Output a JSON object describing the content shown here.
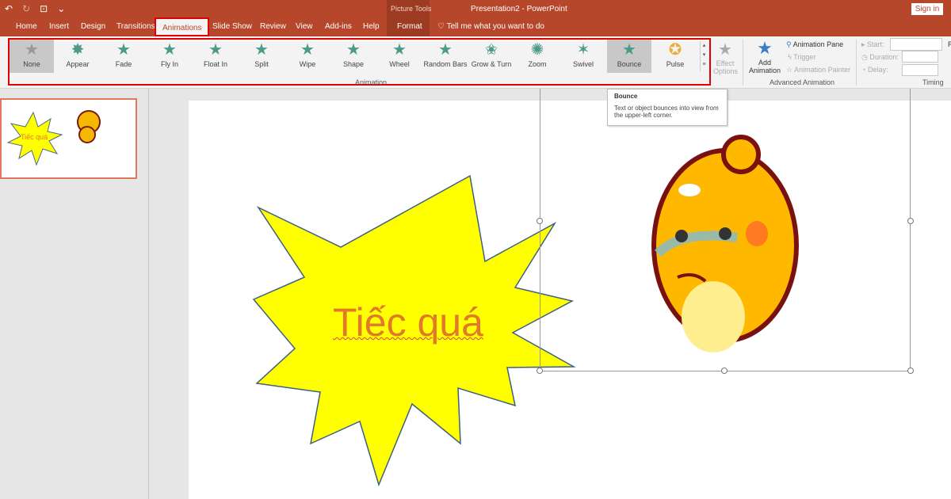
{
  "titlebar": {
    "context_group": "Picture Tools",
    "document_title": "Presentation2  -  PowerPoint",
    "sign_in": "Sign in",
    "qat": {
      "undo": "↶",
      "redo": "↻",
      "present": "⊡",
      "more": "⌄"
    }
  },
  "tabs": [
    {
      "label": "Home"
    },
    {
      "label": "Insert"
    },
    {
      "label": "Design"
    },
    {
      "label": "Transitions"
    },
    {
      "label": "Animations",
      "active": true
    },
    {
      "label": "Slide Show"
    },
    {
      "label": "Review"
    },
    {
      "label": "View"
    },
    {
      "label": "Add-ins"
    },
    {
      "label": "Help"
    },
    {
      "label": "Format"
    }
  ],
  "tell_me": "Tell me what you want to do",
  "animation_gallery": {
    "group_label": "Animation",
    "items": [
      {
        "label": "None"
      },
      {
        "label": "Appear"
      },
      {
        "label": "Fade"
      },
      {
        "label": "Fly In"
      },
      {
        "label": "Float In"
      },
      {
        "label": "Split"
      },
      {
        "label": "Wipe"
      },
      {
        "label": "Shape"
      },
      {
        "label": "Wheel"
      },
      {
        "label": "Random Bars"
      },
      {
        "label": "Grow & Turn"
      },
      {
        "label": "Zoom"
      },
      {
        "label": "Swivel"
      },
      {
        "label": "Bounce"
      },
      {
        "label": "Pulse"
      }
    ]
  },
  "effect_options": {
    "line1": "Effect",
    "line2": "Options"
  },
  "advanced_animation": {
    "group_label": "Advanced Animation",
    "add_line1": "Add",
    "add_line2": "Animation",
    "pane": "Animation Pane",
    "trigger": "Trigger",
    "painter": "Animation Painter"
  },
  "timing": {
    "group_label": "Timing",
    "start": "Start:",
    "duration": "Duration:",
    "delay": "Delay:",
    "reorder": "R"
  },
  "tooltip": {
    "title": "Bounce",
    "body": "Text or object bounces into view from the upper-left corner."
  },
  "slide": {
    "shape_text": "Tiếc quá"
  },
  "thumbnail": {
    "shape_text": "Tiếc quá"
  },
  "colors": {
    "accent": "#b7472a",
    "highlight": "#e00000",
    "shape_fill": "#ffff00",
    "text": "#e07a2a"
  }
}
